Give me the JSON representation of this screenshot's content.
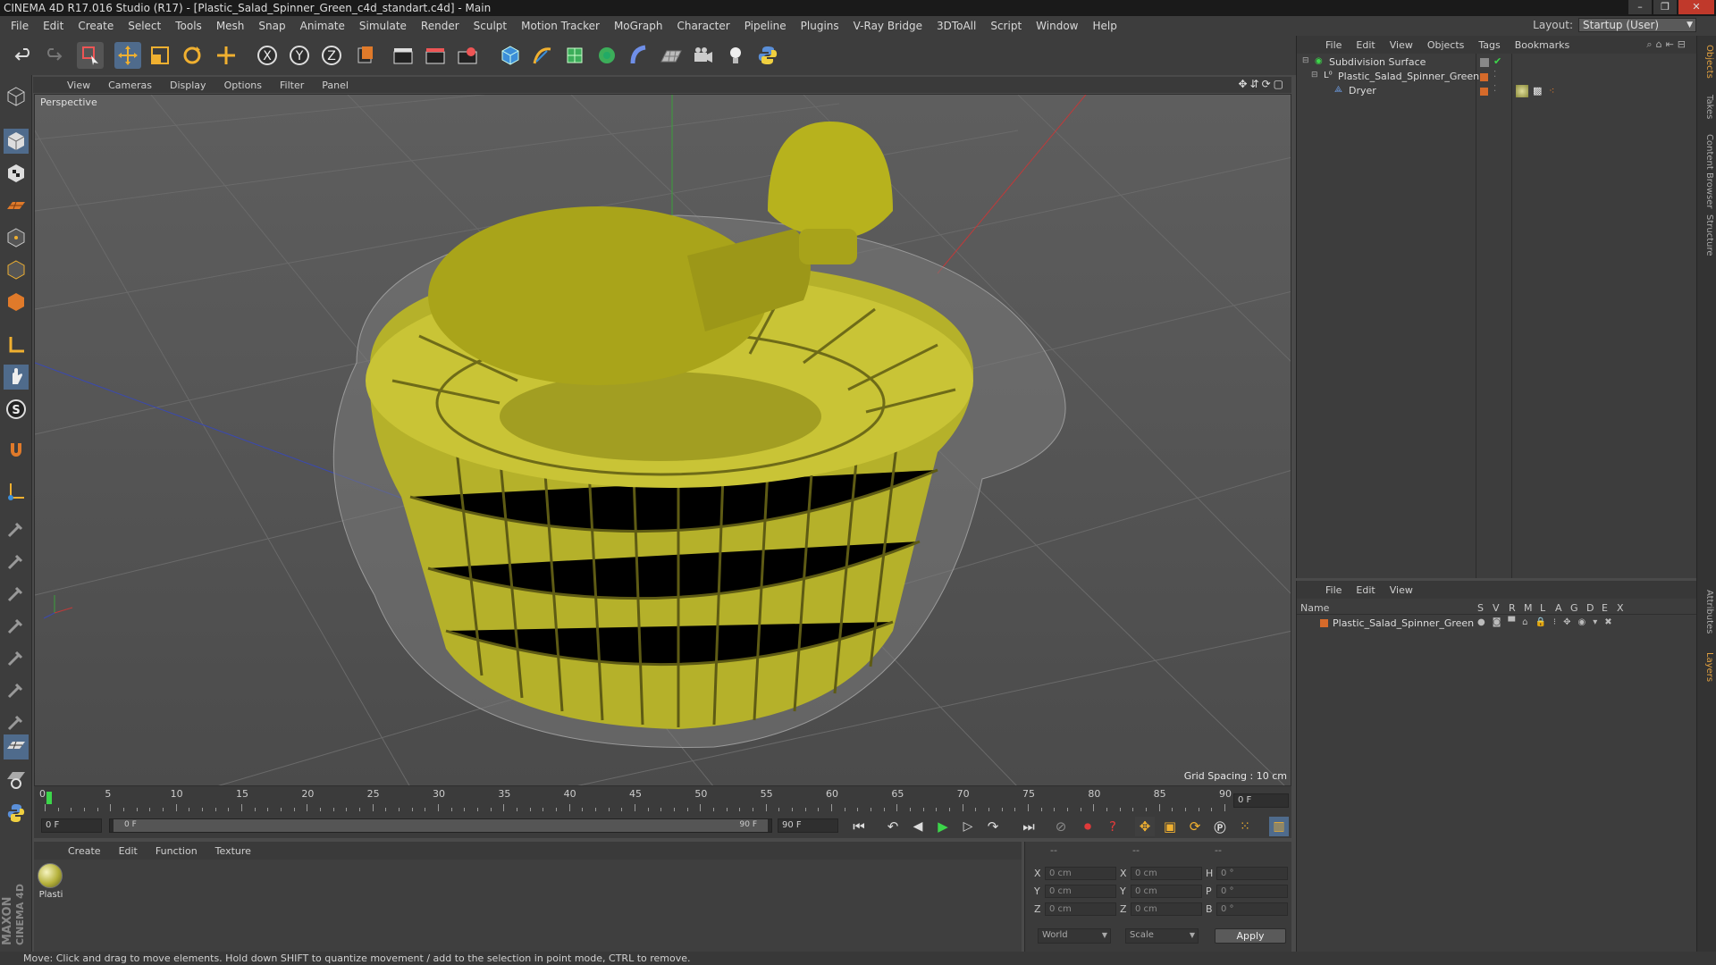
{
  "window": {
    "title": "CINEMA 4D R17.016 Studio (R17) - [Plastic_Salad_Spinner_Green_c4d_standart.c4d] - Main",
    "min": "–",
    "max": "❐",
    "close": "✕"
  },
  "menubar": {
    "items": [
      "File",
      "Edit",
      "Create",
      "Select",
      "Tools",
      "Mesh",
      "Snap",
      "Animate",
      "Simulate",
      "Render",
      "Sculpt",
      "Motion Tracker",
      "MoGraph",
      "Character",
      "Pipeline",
      "Plugins",
      "V-Ray Bridge",
      "3DToAll",
      "Script",
      "Window",
      "Help"
    ],
    "layout_label": "Layout:",
    "layout_value": "Startup (User)"
  },
  "viewport": {
    "menu": [
      "View",
      "Cameras",
      "Display",
      "Options",
      "Filter",
      "Panel"
    ],
    "label": "Perspective",
    "grid_spacing": "Grid Spacing : 10 cm"
  },
  "timeline": {
    "ticks": [
      "0",
      "5",
      "10",
      "15",
      "20",
      "25",
      "30",
      "35",
      "40",
      "45",
      "50",
      "55",
      "60",
      "65",
      "70",
      "75",
      "80",
      "85",
      "90"
    ],
    "current_frame_right": "0 F",
    "start_field": "0 F",
    "range_start": "0 F",
    "range_end": "90 F",
    "end_field": "90 F"
  },
  "materials": {
    "menu": [
      "Create",
      "Edit",
      "Function",
      "Texture"
    ],
    "items": [
      {
        "label": "Plasti"
      }
    ]
  },
  "coords": {
    "header": [
      "--",
      "--",
      "--"
    ],
    "rows": [
      {
        "a": "X",
        "av": "0 cm",
        "b": "X",
        "bv": "0 cm",
        "c": "H",
        "cv": "0 °"
      },
      {
        "a": "Y",
        "av": "0 cm",
        "b": "Y",
        "bv": "0 cm",
        "c": "P",
        "cv": "0 °"
      },
      {
        "a": "Z",
        "av": "0 cm",
        "b": "Z",
        "bv": "0 cm",
        "c": "B",
        "cv": "0 °"
      }
    ],
    "mode": "World",
    "type": "Scale",
    "apply": "Apply"
  },
  "object_manager": {
    "menu": [
      "File",
      "Edit",
      "View",
      "Objects",
      "Tags",
      "Bookmarks"
    ],
    "objects": [
      {
        "name": "Subdivision Surface",
        "indent": 0
      },
      {
        "name": "Plastic_Salad_Spinner_Green",
        "indent": 1
      },
      {
        "name": "Dryer",
        "indent": 2
      }
    ]
  },
  "layer_manager": {
    "menu": [
      "File",
      "Edit",
      "View"
    ],
    "columns": [
      "Name",
      "S",
      "V",
      "R",
      "M",
      "L",
      "A",
      "G",
      "D",
      "E",
      "X"
    ],
    "layers": [
      {
        "name": "Plastic_Salad_Spinner_Green",
        "color": "#d56a2a"
      }
    ]
  },
  "right_tabs": [
    "Objects",
    "Takes",
    "Content Browser",
    "Structure",
    "Attributes",
    "Layers"
  ],
  "status": "Move: Click and drag to move elements. Hold down SHIFT to quantize movement / add to the selection in point mode, CTRL to remove.",
  "brand": [
    "MAXON",
    "CINEMA 4D"
  ]
}
